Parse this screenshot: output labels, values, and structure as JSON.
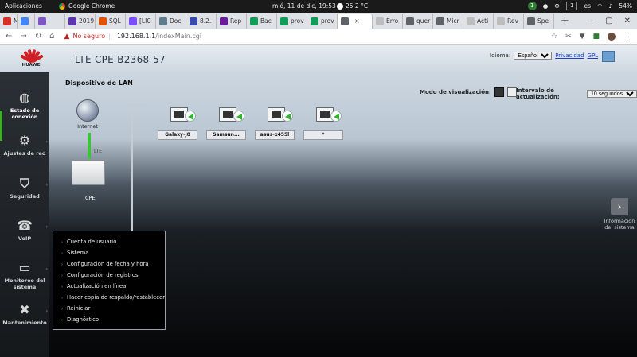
{
  "os": {
    "apps_label": "Aplicaciones",
    "active_app": "Google Chrome",
    "clock": "mié, 11 de dic, 19:53",
    "weather": "25,2 °C",
    "notif_count": "1",
    "workspace": "1",
    "lang": "es",
    "battery": "54%"
  },
  "tabs": [
    {
      "label": "M",
      "color": "#d93025"
    },
    {
      "label": "",
      "color": "#4285f4"
    },
    {
      "label": "",
      "color": "#7e57c2"
    },
    {
      "label": "2019",
      "color": "#5e35b1"
    },
    {
      "label": "SQL",
      "color": "#e65100"
    },
    {
      "label": "[LIC",
      "color": "#7c4dff"
    },
    {
      "label": "Doc",
      "color": "#607d8b"
    },
    {
      "label": "8.2.",
      "color": "#3949ab"
    },
    {
      "label": "Rep",
      "color": "#6a1b9a"
    },
    {
      "label": "Bac",
      "color": "#0f9d58"
    },
    {
      "label": "prov",
      "color": "#0f9d58"
    },
    {
      "label": "prov",
      "color": "#0f9d58"
    },
    {
      "label": "",
      "color": "#5f6368",
      "active": true
    },
    {
      "label": "Erro",
      "color": "#bdbdbd"
    },
    {
      "label": "quer",
      "color": "#5f6368"
    },
    {
      "label": "Micr",
      "color": "#5f6368"
    },
    {
      "label": "Acti",
      "color": "#bdbdbd"
    },
    {
      "label": "Rev",
      "color": "#bdbdbd"
    },
    {
      "label": "Spe",
      "color": "#5f6368"
    }
  ],
  "address": {
    "security": "No seguro",
    "host": "192.168.1.1",
    "path": "/indexMain.cgi"
  },
  "header": {
    "brand": "HUAWEI",
    "product": "LTE CPE B2368-57",
    "language_label": "Idioma:",
    "language_value": "Español",
    "privacy_link": "Privacidad",
    "gpl_link": "GPL"
  },
  "sidebar": [
    {
      "label": "Estado de conexión",
      "icon": "globe-icon",
      "glyph": "◍"
    },
    {
      "label": "Ajustes de red",
      "icon": "gears-icon",
      "glyph": "⚙"
    },
    {
      "label": "Seguridad",
      "icon": "shield-icon",
      "glyph": "⛉"
    },
    {
      "label": "VoIP",
      "icon": "phone-icon",
      "glyph": "☎"
    },
    {
      "label": "Monitoreo del sistema",
      "icon": "monitor-icon",
      "glyph": "▭"
    },
    {
      "label": "Mantenimiento",
      "icon": "wrench-icon",
      "glyph": "✖"
    }
  ],
  "content": {
    "title": "Dispositivo de LAN",
    "view_mode_label": "Modo de visualización:",
    "refresh_label": "Intervalo de actualización:",
    "refresh_value": "10 segundos",
    "internet_label": "Internet",
    "lte_label": "LTE",
    "cpe_label": "CPE",
    "devices": [
      {
        "name": "Galaxy-J8"
      },
      {
        "name": "Samsun..."
      },
      {
        "name": "asus-x455l"
      },
      {
        "name": "*"
      }
    ]
  },
  "maintenance_menu": [
    "Cuenta de usuario",
    "Sistema",
    "Configuración de fecha y hora",
    "Configuración de registros",
    "Actualización en línea",
    "Hacer copia de respaldo/restablecer",
    "Reiniciar",
    "Diagnóstico"
  ],
  "sys_info_label": "Información del sistema"
}
